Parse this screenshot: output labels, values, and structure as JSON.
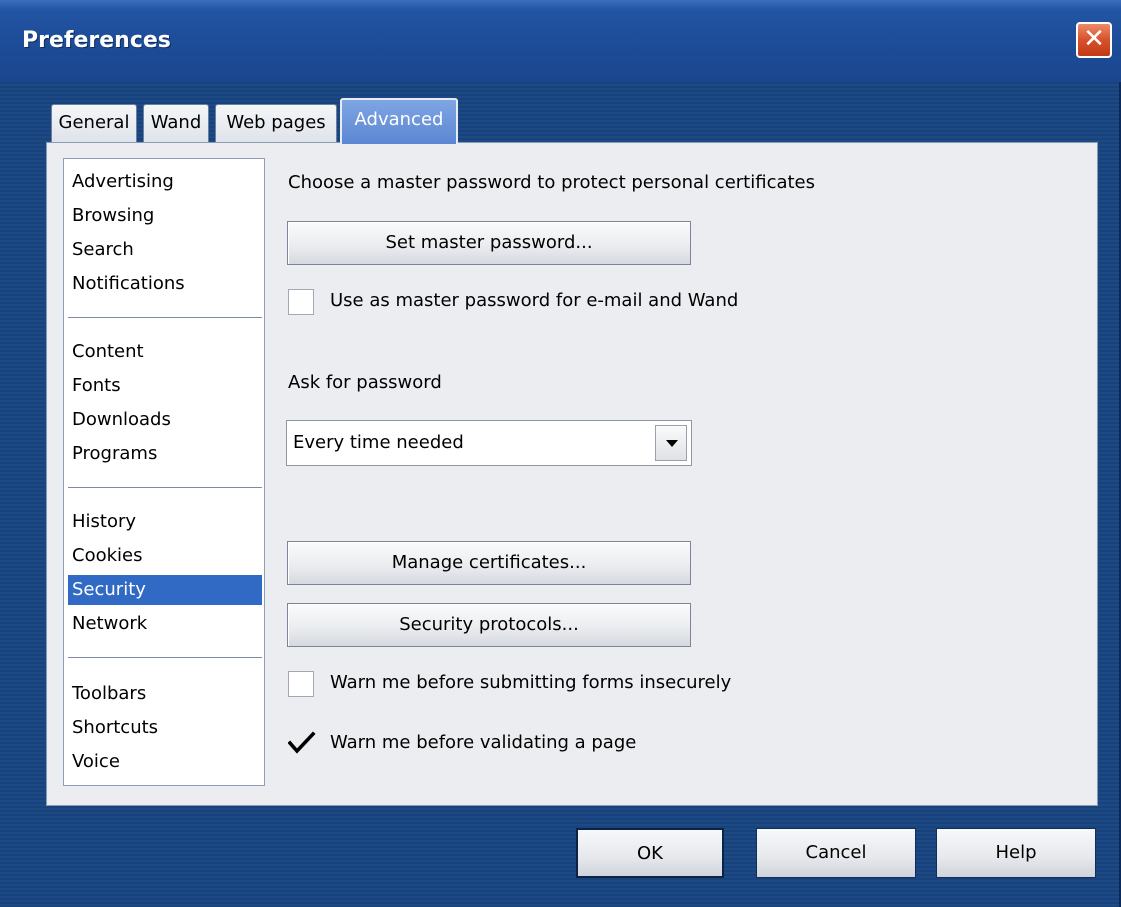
{
  "window": {
    "title": "Preferences",
    "close_symbol": "✕"
  },
  "tabs": [
    {
      "label": "General"
    },
    {
      "label": "Wand"
    },
    {
      "label": "Web pages"
    },
    {
      "label": "Advanced",
      "active": true
    }
  ],
  "sidebar": {
    "items": [
      {
        "label": "Advertising"
      },
      {
        "label": "Browsing"
      },
      {
        "label": "Search"
      },
      {
        "label": "Notifications"
      },
      {
        "label": "Content"
      },
      {
        "label": "Fonts"
      },
      {
        "label": "Downloads"
      },
      {
        "label": "Programs"
      },
      {
        "label": "History"
      },
      {
        "label": "Cookies"
      },
      {
        "label": "Security",
        "selected": true
      },
      {
        "label": "Network"
      },
      {
        "label": "Toolbars"
      },
      {
        "label": "Shortcuts"
      },
      {
        "label": "Voice"
      }
    ]
  },
  "security": {
    "master_password_heading": "Choose a master password to protect personal certificates",
    "set_master_password_button": "Set master password...",
    "use_master_for_mail_wand": {
      "label": "Use as master password for e-mail and Wand",
      "checked": false
    },
    "ask_for_password_label": "Ask for password",
    "ask_for_password_select": {
      "value": "Every time needed"
    },
    "manage_certificates_button": "Manage certificates...",
    "security_protocols_button": "Security protocols...",
    "warn_insecure_forms": {
      "label": "Warn me before submitting forms insecurely",
      "checked": false
    },
    "warn_validating_page": {
      "label": "Warn me before validating a page",
      "checked": true
    }
  },
  "footer": {
    "ok_label": "OK",
    "cancel_label": "Cancel",
    "help_label": "Help"
  },
  "colors": {
    "titlebar": "#1d4c98",
    "selection": "#316ac5",
    "close_button": "#d7512b",
    "panel": "#ebedf0"
  }
}
